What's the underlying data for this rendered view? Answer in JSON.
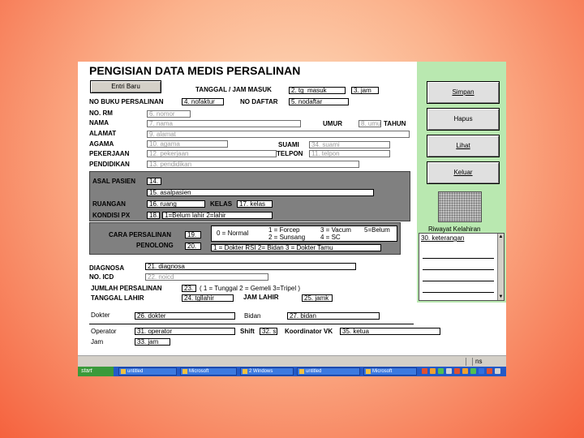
{
  "form": {
    "title": "PENGISIAN DATA MEDIS PERSALINAN",
    "entri_baru": "Entri Baru",
    "tanggal_jam_masuk": {
      "label": "TANGGAL / JAM MASUK",
      "tgl": "2. tg_masuk",
      "jam": "3. jam"
    },
    "no_buku": {
      "label": "NO BUKU PERSALINAN",
      "value": "4. nofaktur"
    },
    "no_daftar": {
      "label": "NO DAFTAR",
      "value": "5. nodaftar"
    },
    "no_rm": {
      "label": "NO. RM",
      "value": "6. nomor"
    },
    "nama": {
      "label": "NAMA",
      "value": "7. nama"
    },
    "umur": {
      "label": "UMUR",
      "value": "8. umur",
      "unit": "TAHUN"
    },
    "alamat": {
      "label": "ALAMAT",
      "value": "9. alamat"
    },
    "agama": {
      "label": "AGAMA",
      "value": "10. agama"
    },
    "suami": {
      "label": "SUAMI",
      "value": "34. suami"
    },
    "pekerjaan": {
      "label": "PEKERJAAN",
      "value": "12. pekerjaan"
    },
    "telpon": {
      "label": "TELPON",
      "value": "11. telpon"
    },
    "pendidikan": {
      "label": "PENDIDIKAN",
      "value": "13. pendidikan"
    },
    "asal_pasien": {
      "label": "ASAL PASIEN",
      "code": "14.",
      "value": "15. asalpasien"
    },
    "ruangan": {
      "label": "RUANGAN",
      "value": "16. ruang"
    },
    "kelas": {
      "label": "KELAS",
      "value": "17. kelas"
    },
    "kondisi": {
      "label": "KONDISI PX",
      "code": "18.",
      "note": "1=Belum lahir        2=lahir"
    },
    "cara_persalinan": {
      "label": "CARA PERSALINAN",
      "code": "19.",
      "legend1": "0 = Normal",
      "legend2": "1 = Forcep",
      "legend3": "2 = Sunsang",
      "legend4": "3 = Vacum",
      "legend5": "4 = SC",
      "legend6": "5=Belum"
    },
    "penolong": {
      "label": "PENOLONG",
      "code": "20.",
      "legend": "1 = Dokter RSI   2= Bidan   3 = Dokter Tamu"
    },
    "diagnosa": {
      "label": "DIAGNOSA",
      "value": "21. diagnosa"
    },
    "no_icd": {
      "label": "NO. ICD",
      "value": "22. noicd"
    },
    "jumlah": {
      "label": "JUMLAH PERSALINAN",
      "code": "23.",
      "legend": "( 1 = Tunggal    2 = Gemeli     3=Tripel )"
    },
    "tanggal_lahir": {
      "label": "TANGGAL LAHIR",
      "value": "24. tgllahir"
    },
    "jam_lahir": {
      "label": "JAM LAHIR",
      "value": "25. jamk"
    },
    "dokter": {
      "label": "Dokter",
      "value": "26. dokter"
    },
    "bidan": {
      "label": "Bidan",
      "value": "27. bidan"
    },
    "operator": {
      "label": "Operator",
      "value": "31. operator"
    },
    "shift": {
      "label": "Shift",
      "value": "32. s"
    },
    "koordinator": {
      "label": "Koordinator VK",
      "value": "35. ketua"
    },
    "jam": {
      "label": "Jam",
      "value": "33. jam"
    }
  },
  "sidebar": {
    "simpan": "Simpan",
    "hapus": "Hapus",
    "lihat": "Lihat",
    "keluar": "Keluar",
    "riwayat_label": "Riwayat Kelahiran",
    "riwayat_value": "30. keterangan"
  },
  "statusbar": {
    "indicator": "ns"
  },
  "taskbar": {
    "start": "start",
    "items": [
      "untitled",
      "Microsoft",
      "2 Windows",
      "untitled",
      "Microsoft"
    ]
  },
  "colors": {
    "panel": "#808080",
    "sidebar": "#b9e8b0",
    "taskbar": "#235ac8"
  }
}
